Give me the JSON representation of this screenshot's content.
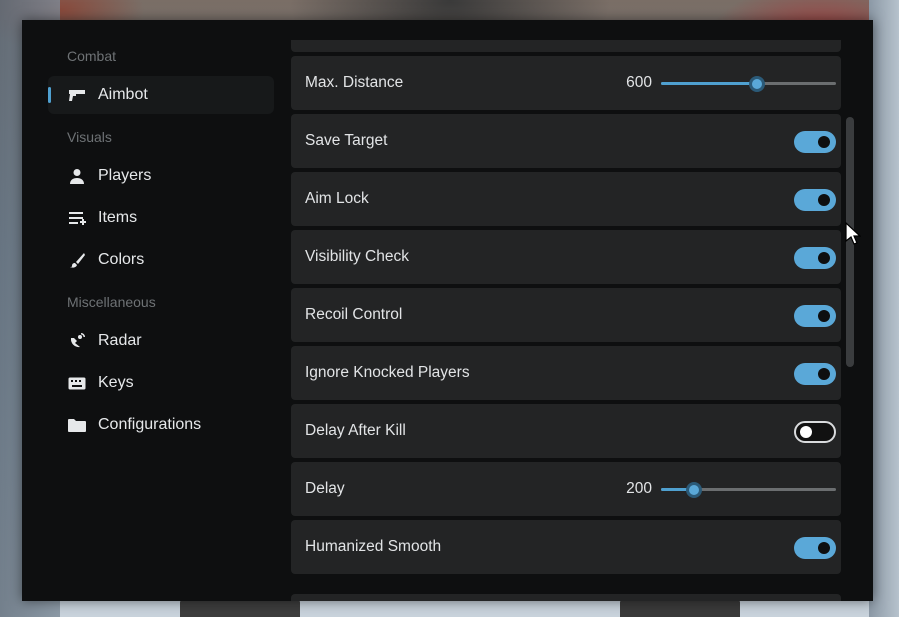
{
  "sidebar": {
    "sections": [
      {
        "label": "Combat"
      },
      {
        "label": "Visuals"
      },
      {
        "label": "Miscellaneous"
      }
    ],
    "items": [
      {
        "label": "Aimbot",
        "icon": "gun-icon",
        "active": true
      },
      {
        "label": "Players",
        "icon": "person-icon"
      },
      {
        "label": "Items",
        "icon": "list-add-icon"
      },
      {
        "label": "Colors",
        "icon": "brush-icon"
      },
      {
        "label": "Radar",
        "icon": "satellite-dish-icon"
      },
      {
        "label": "Keys",
        "icon": "keyboard-icon"
      },
      {
        "label": "Configurations",
        "icon": "folder-icon"
      }
    ]
  },
  "settings": [
    {
      "label": "Max. Distance",
      "type": "slider",
      "value": "600",
      "fraction": 0.55
    },
    {
      "label": "Save Target",
      "type": "toggle",
      "on": true
    },
    {
      "label": "Aim Lock",
      "type": "toggle",
      "on": true
    },
    {
      "label": "Visibility Check",
      "type": "toggle",
      "on": true
    },
    {
      "label": "Recoil Control",
      "type": "toggle",
      "on": true
    },
    {
      "label": "Ignore Knocked Players",
      "type": "toggle",
      "on": true
    },
    {
      "label": "Delay After Kill",
      "type": "toggle",
      "on": false
    },
    {
      "label": "Delay",
      "type": "slider",
      "value": "200",
      "fraction": 0.19
    },
    {
      "label": "Humanized Smooth",
      "type": "toggle",
      "on": true
    }
  ],
  "colors": {
    "accent": "#4fa0d0",
    "panel": "#0e0f10",
    "row": "#232425"
  }
}
